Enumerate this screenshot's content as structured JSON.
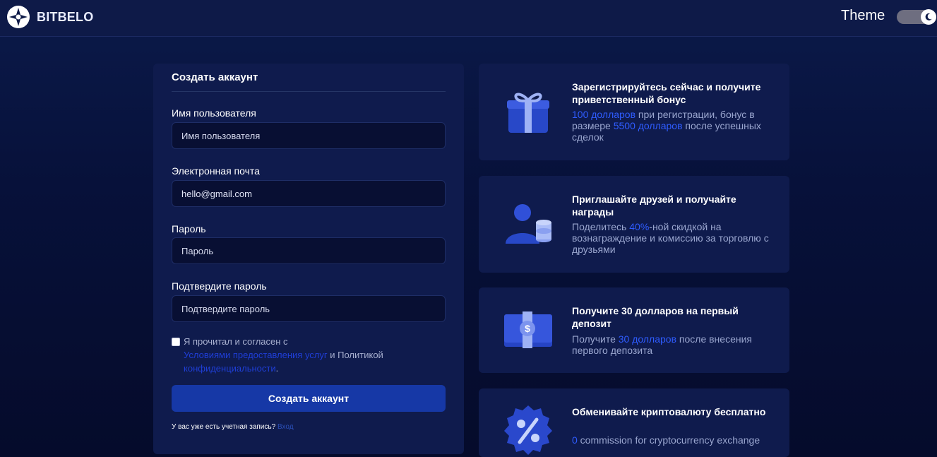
{
  "header": {
    "brand": "BITBELO",
    "theme_label": "Theme",
    "theme_mode": "dark"
  },
  "form": {
    "title": "Создать аккаунт",
    "username": {
      "label": "Имя пользователя",
      "placeholder": "Имя пользователя",
      "value": ""
    },
    "email": {
      "label": "Электронная почта",
      "placeholder": "",
      "value": "hello@gmail.com"
    },
    "password": {
      "label": "Пароль",
      "placeholder": "Пароль",
      "value": ""
    },
    "confirm": {
      "label": "Подтвердите пароль",
      "placeholder": "Подтвердите пароль",
      "value": ""
    },
    "agree": {
      "checked": false,
      "prefix": "Я прочитал и согласен с",
      "terms_link": "Условиями предоставления услуг",
      "middle": "и Политикой",
      "privacy_link": "конфиденциальности",
      "suffix": "."
    },
    "submit_label": "Создать аккаунт",
    "login_prompt": "У вас уже есть учетная запись?",
    "login_link": "Вход"
  },
  "benefits": [
    {
      "icon": "gift-icon",
      "title": "Зарегистрируйтесь сейчас и получите приветственный бонус",
      "desc": [
        {
          "text": "100 долларов",
          "hl": true
        },
        {
          "text": " при регистрации, бонус в размере ",
          "hl": false
        },
        {
          "text": "5500 долларов",
          "hl": true
        },
        {
          "text": " после успешных сделок",
          "hl": false
        }
      ]
    },
    {
      "icon": "user-coins-icon",
      "title": "Приглашайте друзей и получайте награды",
      "desc": [
        {
          "text": "Поделитесь ",
          "hl": false
        },
        {
          "text": "40%",
          "hl": true
        },
        {
          "text": "-ной скидкой на вознаграждение и комиссию за торговлю с друзьями",
          "hl": false
        }
      ]
    },
    {
      "icon": "money-stack-icon",
      "title": "Получите 30 долларов на первый депозит",
      "desc": [
        {
          "text": "Получите ",
          "hl": false
        },
        {
          "text": "30 долларов",
          "hl": true
        },
        {
          "text": " после внесения первого депозита",
          "hl": false
        }
      ]
    },
    {
      "icon": "percent-badge-icon",
      "title": "Обменивайте криптовалюту бесплатно",
      "desc": [
        {
          "text": "0",
          "hl": true
        },
        {
          "text": " commission for cryptocurrency exchange",
          "hl": false
        }
      ]
    }
  ],
  "colors": {
    "accent": "#1638a6",
    "highlight": "#2f5cff",
    "card": "#0f1b4d",
    "input_bg": "#080f33"
  }
}
